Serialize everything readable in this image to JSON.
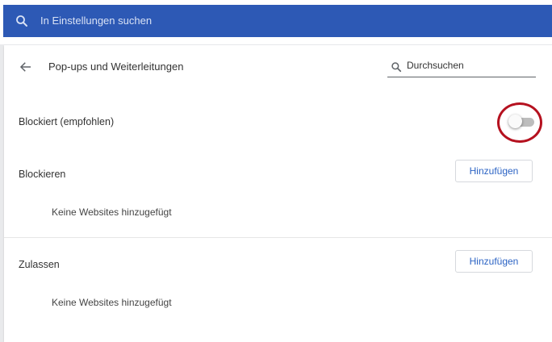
{
  "top_search": {
    "placeholder": "In Einstellungen suchen"
  },
  "page": {
    "title": "Pop-ups und Weiterleitungen",
    "search_placeholder": "Durchsuchen"
  },
  "blocked_setting": {
    "label": "Blockiert (empfohlen)",
    "toggle_on": false
  },
  "block_section": {
    "label": "Blockieren",
    "add_button": "Hinzufügen",
    "empty_text": "Keine Websites hinzugefügt"
  },
  "allow_section": {
    "label": "Zulassen",
    "add_button": "Hinzufügen",
    "empty_text": "Keine Websites hinzugefügt"
  },
  "colors": {
    "header_blue": "#2d59b5",
    "accent_blue": "#2b63c4",
    "highlight_red": "#b5111f"
  }
}
